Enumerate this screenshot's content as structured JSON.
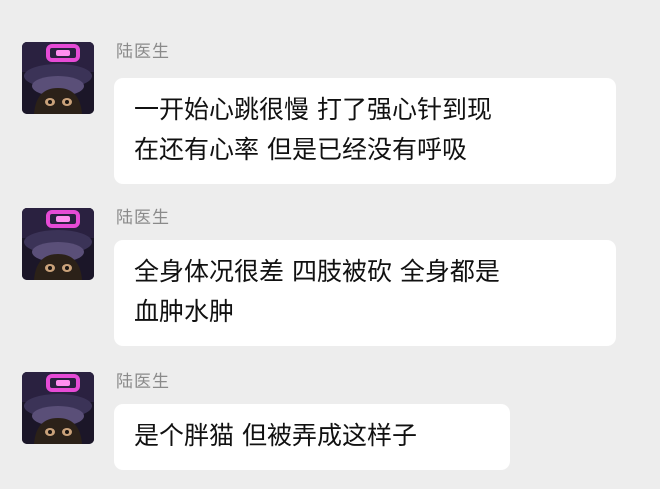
{
  "messages": [
    {
      "sender": "陆医生",
      "lines": [
        "一开始心跳很慢 打了强心针到现",
        "在还有心率 但是已经没有呼吸"
      ]
    },
    {
      "sender": "陆医生",
      "lines": [
        "全身体况很差 四肢被砍 全身都是",
        "血肿水肿"
      ]
    },
    {
      "sender": "陆医生",
      "lines": [
        "是个胖猫 但被弄成这样子"
      ]
    }
  ],
  "colors": {
    "background": "#ededed",
    "bubble": "#ffffff",
    "sender_name": "#8a8a8a",
    "text": "#111111",
    "avatar_accent": "#e64bd6"
  },
  "icons": {
    "avatar": "avatar-image"
  }
}
